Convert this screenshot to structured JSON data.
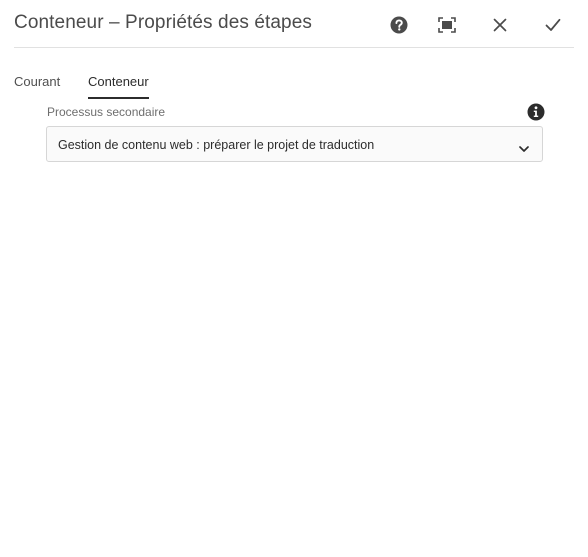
{
  "dialog": {
    "title": "Conteneur – Propriétés des étapes",
    "actions": {
      "help_icon": "help-circle-icon",
      "fullscreen_icon": "fullscreen-icon",
      "close_icon": "close-icon",
      "confirm_icon": "checkmark-icon"
    }
  },
  "tabs": [
    {
      "label": "Courant",
      "active": false
    },
    {
      "label": "Conteneur",
      "active": true
    }
  ],
  "form": {
    "subprocess": {
      "label": "Processus secondaire",
      "info_icon": "info-icon",
      "value": "Gestion de contenu web : préparer le projet de traduction",
      "dropdown_icon": "chevron-down-icon"
    }
  },
  "colors": {
    "text": "#2c2c2c",
    "muted": "#6e6e6e",
    "border": "#d6d6d6",
    "background": "#ffffff"
  }
}
